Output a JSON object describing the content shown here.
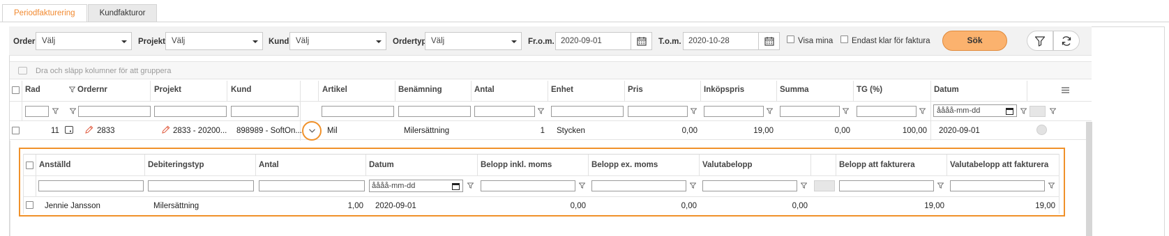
{
  "tabs": [
    {
      "label": "Periodfakturering",
      "active": true
    },
    {
      "label": "Kundfakturor",
      "active": false
    }
  ],
  "filters": {
    "order_label": "Order",
    "order_value": "Välj",
    "project_label": "Projekt",
    "project_value": "Välj",
    "customer_label": "Kund",
    "customer_value": "Välj",
    "ordertype_label": "Ordertyp",
    "ordertype_value": "Välj",
    "from_label": "Fr.o.m.",
    "from_value": "2020-09-01",
    "to_label": "T.o.m.",
    "to_value": "2020-10-28",
    "show_mine_label": "Visa mina",
    "show_mine_checked": false,
    "only_ready_label": "Endast klar för faktura",
    "only_ready_checked": false,
    "search_label": "Sök"
  },
  "group_hint": "Dra och släpp kolumner för att gruppera",
  "grid": {
    "headers": {
      "rad": "Rad",
      "ordernr": "Ordernr",
      "projekt": "Projekt",
      "kund": "Kund",
      "artikel": "Artikel",
      "benamning": "Benämning",
      "antal": "Antal",
      "enhet": "Enhet",
      "pris": "Pris",
      "inkopspris": "Inköpspris",
      "summa": "Summa",
      "tg": "TG (%)",
      "datum": "Datum"
    },
    "date_placeholder": "åååå-mm-dd",
    "row": {
      "rad": "11",
      "ordernr": "2833",
      "projekt": "2833 - 20200...",
      "kund": "898989 - SoftOn...",
      "artikel": "Mil",
      "benamning": "Milersättning",
      "antal": "1",
      "enhet": "Stycken",
      "pris": "0,00",
      "inkopspris": "19,00",
      "summa": "0,00",
      "tg": "100,00",
      "datum": "2020-09-01"
    }
  },
  "detail": {
    "headers": {
      "anstalld": "Anställd",
      "debiteringstyp": "Debiteringstyp",
      "antal": "Antal",
      "datum": "Datum",
      "belopp_inkl": "Belopp inkl. moms",
      "belopp_ex": "Belopp ex. moms",
      "valutabelopp": "Valutabelopp",
      "belopp_fakt": "Belopp att fakturera",
      "valuta_fakt": "Valutabelopp att fakturera"
    },
    "date_placeholder": "åååå-mm-dd",
    "row": {
      "anstalld": "Jennie Jansson",
      "debiteringstyp": "Milersättning",
      "antal": "1,00",
      "datum": "2020-09-01",
      "belopp_inkl": "0,00",
      "belopp_ex": "0,00",
      "valutabelopp": "0,00",
      "belopp_fakt": "19,00",
      "valuta_fakt": "19,00"
    }
  },
  "colors": {
    "accent": "#f28a30",
    "button": "#fbb26e",
    "highlight_border": "#f0912a"
  }
}
